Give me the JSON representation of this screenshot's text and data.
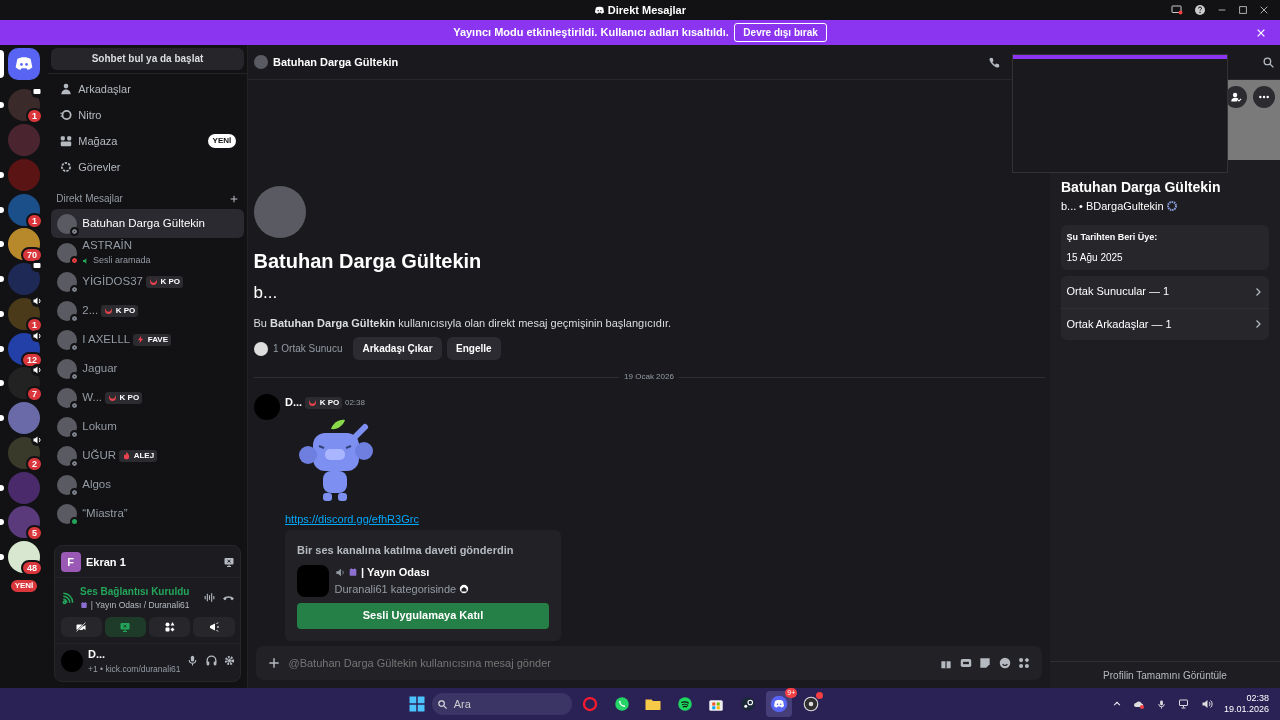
{
  "window": {
    "title": "Direkt Mesajlar"
  },
  "banner": {
    "text": "Yayıncı Modu etkinleştirildi. Kullanıcı adları kısaltıldı.",
    "button": "Devre dışı bırak"
  },
  "home": {
    "selected": true
  },
  "servers": [
    {
      "badge": "1",
      "kind": "stream",
      "unread": true
    },
    {
      "kind": "plain",
      "unread": false
    },
    {
      "kind": "plain",
      "unread": true
    },
    {
      "badge": "1",
      "kind": "plain",
      "unread": true
    },
    {
      "badge": "70",
      "kind": "plain",
      "unread": true
    },
    {
      "kind": "stream",
      "unread": true
    },
    {
      "badge": "1",
      "kind": "voice",
      "unread": true
    },
    {
      "badge": "12",
      "kind": "voice",
      "unread": true
    },
    {
      "badge": "7",
      "kind": "voice",
      "unread": true
    },
    {
      "kind": "plain",
      "unread": true
    },
    {
      "badge": "2",
      "kind": "voice",
      "unread": false
    },
    {
      "kind": "plain",
      "unread": true
    },
    {
      "badge": "5",
      "kind": "plain",
      "unread": true
    },
    {
      "badge": "48",
      "kind": "plain",
      "unread": true
    }
  ],
  "new_pill": "YENİ",
  "sidebar": {
    "search": "Sohbet bul ya da başlat",
    "nav": [
      {
        "label": "Arkadaşlar"
      },
      {
        "label": "Nitro"
      },
      {
        "label": "Mağaza",
        "badge": "YENİ"
      },
      {
        "label": "Görevler"
      }
    ],
    "section": "Direkt Mesajlar",
    "dms": [
      {
        "name": "Batuhan Darga Gültekin",
        "dnd": false,
        "online": false,
        "selected": true
      },
      {
        "name": "ASTRAİN",
        "subtitle": "Sesli aramada",
        "dnd": true,
        "online": false,
        "selected": false
      },
      {
        "name": "YİGİDOS37",
        "tag": {
          "text": "K PO",
          "kind": "moon"
        },
        "dnd": false,
        "online": false,
        "selected": false
      },
      {
        "name": "2...",
        "tag": {
          "text": "K PO",
          "kind": "moon"
        },
        "dnd": false,
        "online": false,
        "selected": false
      },
      {
        "name": "I AXELLL",
        "tag": {
          "text": "FAVE",
          "kind": "bolt"
        },
        "dnd": false,
        "online": false,
        "selected": false
      },
      {
        "name": "Jaguar",
        "dnd": false,
        "online": false,
        "selected": false
      },
      {
        "name": "W...",
        "tag": {
          "text": "K PO",
          "kind": "moon"
        },
        "dnd": false,
        "online": false,
        "selected": false
      },
      {
        "name": "Lokum",
        "dnd": false,
        "online": false,
        "selected": false
      },
      {
        "name": "UĞUR",
        "tag": {
          "text": "ALEJ",
          "kind": "flame"
        },
        "dnd": false,
        "online": false,
        "selected": false
      },
      {
        "name": "Algos",
        "dnd": false,
        "online": false,
        "selected": false
      },
      {
        "name": "“Miastra”",
        "dnd": false,
        "online": true,
        "selected": false
      }
    ]
  },
  "voice": {
    "stream": "Ekran 1",
    "stream_initial": "F",
    "status": "Ses Bağlantısı Kuruldu",
    "channel": "| Yayın Odası / Duranali61",
    "controls": [
      {
        "on": false
      },
      {
        "on": true
      },
      {
        "on": false
      },
      {
        "on": false
      }
    ]
  },
  "user": {
    "name": "D...",
    "status": "+1 • kick.com/duranali61"
  },
  "header": {
    "title": "Batuhan Darga Gültekin"
  },
  "intro": {
    "name": "Batuhan Darga Gültekin",
    "username": "b...",
    "text": "Bu **Batuhan Darga Gültekin** kullanıcısıyla olan direkt mesaj geçmişinin başlangıcıdır.",
    "mutual": "1 Ortak Sunucu",
    "buttons": [
      "Arkadaşı Çıkar",
      "Engelle"
    ]
  },
  "date_divider": "19 Ocak 2026",
  "message": {
    "author": "D...",
    "tag": {
      "text": "K PO",
      "kind": "moon"
    },
    "time": "02:38",
    "link": "https://discord.gg/efhR3Grc",
    "invite": {
      "title": "Bir ses kanalına katılma daveti gönderdin",
      "channel": "| Yayın Odası",
      "category": "Duranali61 kategorisinde",
      "button": "Sesli Uygulamaya Katıl"
    }
  },
  "composer": {
    "placeholder": "@Batuhan Darga Gültekin kullanıcısına mesaj gönder"
  },
  "profile": {
    "name": "Batuhan Darga Gültekin",
    "username": "b...",
    "handle": "• BDargaGultekin",
    "member_label": "Şu Tarihten Beri Üye:",
    "member_since": "15 Ağu 2025",
    "links": [
      "Ortak Sunucular — 1",
      "Ortak Arkadaşlar — 1"
    ],
    "footer": "Profilin Tamamını Görüntüle"
  },
  "taskbar": {
    "search": "Ara",
    "apps": [
      {
        "selected": false
      },
      {
        "selected": false
      },
      {
        "selected": false
      },
      {
        "selected": false
      },
      {
        "selected": false
      },
      {
        "selected": false
      },
      {
        "badge": "9+",
        "selected": true
      },
      {
        "alert": true,
        "selected": false
      }
    ],
    "time": "02:38",
    "date": "19.01.2026"
  }
}
